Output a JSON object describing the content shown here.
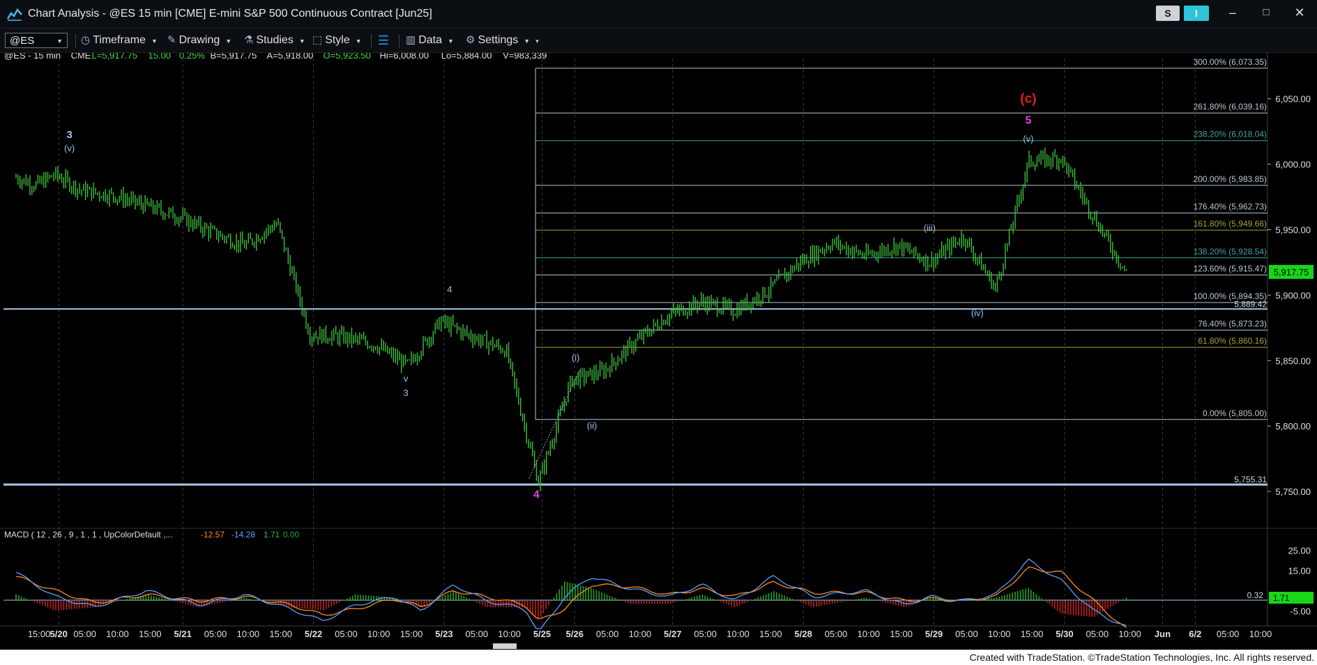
{
  "window": {
    "title": "Chart Analysis - @ES 15 min [CME] E-mini S&P 500 Continuous Contract [Jun25]",
    "s_button": "S",
    "i_button": "I",
    "minimize": "–",
    "maximize": "□",
    "close": "✕"
  },
  "toolbar": {
    "symbol": "@ES",
    "items": [
      "Timeframe",
      "Drawing",
      "Studies",
      "Style",
      "Data",
      "Settings"
    ]
  },
  "colors": {
    "background": "#000000",
    "price_bars": "#3fbf3f",
    "fib_line": "#b9c8d6",
    "fib_teal": "#3aa7a0",
    "fib_olive": "#a8a23a",
    "support_line": "#a8c8e8",
    "wave_label": "#9cc4ee",
    "wave_red": "#e02020",
    "wave_magenta": "#e040e0",
    "macd_line": "#5aa0ff",
    "signal_line": "#ff8c1a",
    "hist_up": "#28a028",
    "hist_down": "#c02020",
    "last_price_badge": "#16d616"
  },
  "chart_data": [
    {
      "type": "line",
      "subtype": "ohlc-bars",
      "info_line": {
        "symbol": "@ES - 15 min",
        "exchange": "CME",
        "last": "L=5,917.75",
        "change": "15.00",
        "pct": "0.25%",
        "bid": "B=5,917.75",
        "ask": "A=5,918.00",
        "open": "O=5,923.50",
        "high": "Hi=6,008.00",
        "low": "Lo=5,884.00",
        "volume": "V=983,339"
      },
      "ylim": [
        5725,
        6085
      ],
      "y_ticks": [
        {
          "value": 6050,
          "label": "6,050.00"
        },
        {
          "value": 6000,
          "label": "6,000.00"
        },
        {
          "value": 5950,
          "label": "5,950.00"
        },
        {
          "value": 5900,
          "label": "5,900.00"
        },
        {
          "value": 5850,
          "label": "5,850.00"
        },
        {
          "value": 5800,
          "label": "5,800.00"
        },
        {
          "value": 5750,
          "label": "5,750.00"
        }
      ],
      "x_ticks": [
        {
          "label": "15:00",
          "bold": false,
          "t": 0.03
        },
        {
          "label": "5/20",
          "bold": true,
          "t": 0.06
        },
        {
          "label": "05:00",
          "bold": false,
          "t": 0.1
        },
        {
          "label": "10:00",
          "bold": false,
          "t": 0.15
        },
        {
          "label": "15:00",
          "bold": false,
          "t": 0.2
        },
        {
          "label": "5/21",
          "bold": true,
          "t": 0.25
        },
        {
          "label": "05:00",
          "bold": false,
          "t": 0.3
        },
        {
          "label": "10:00",
          "bold": false,
          "t": 0.35
        },
        {
          "label": "15:00",
          "bold": false,
          "t": 0.4
        },
        {
          "label": "5/22",
          "bold": true,
          "t": 0.45
        },
        {
          "label": "05:00",
          "bold": false,
          "t": 0.5
        },
        {
          "label": "10:00",
          "bold": false,
          "t": 0.55
        },
        {
          "label": "15:00",
          "bold": false,
          "t": 0.6
        },
        {
          "label": "5/23",
          "bold": true,
          "t": 0.65
        },
        {
          "label": "05:00",
          "bold": false,
          "t": 0.7
        },
        {
          "label": "10:00",
          "bold": false,
          "t": 0.75
        },
        {
          "label": "5/25",
          "bold": true,
          "t": 0.8
        },
        {
          "label": "5/26",
          "bold": true,
          "t": 0.85
        },
        {
          "label": "05:00",
          "bold": false,
          "t": 0.9
        },
        {
          "label": "10:00",
          "bold": false,
          "t": 0.95
        },
        {
          "label": "5/27",
          "bold": true,
          "t": 1.0
        },
        {
          "label": "05:00",
          "bold": false,
          "t": 1.05
        },
        {
          "label": "10:00",
          "bold": false,
          "t": 1.1
        },
        {
          "label": "15:00",
          "bold": false,
          "t": 1.15
        },
        {
          "label": "5/28",
          "bold": true,
          "t": 1.2
        },
        {
          "label": "05:00",
          "bold": false,
          "t": 1.25
        },
        {
          "label": "10:00",
          "bold": false,
          "t": 1.3
        },
        {
          "label": "15:00",
          "bold": false,
          "t": 1.35
        },
        {
          "label": "5/29",
          "bold": true,
          "t": 1.4
        },
        {
          "label": "05:00",
          "bold": false,
          "t": 1.45
        },
        {
          "label": "10:00",
          "bold": false,
          "t": 1.5
        },
        {
          "label": "15:00",
          "bold": false,
          "t": 1.55
        },
        {
          "label": "5/30",
          "bold": true,
          "t": 1.6
        },
        {
          "label": "05:00",
          "bold": false,
          "t": 1.65
        },
        {
          "label": "10:00",
          "bold": false,
          "t": 1.7
        },
        {
          "label": "Jun",
          "bold": true,
          "t": 1.75
        },
        {
          "label": "6/2",
          "bold": true,
          "t": 1.8
        },
        {
          "label": "05:00",
          "bold": false,
          "t": 1.85
        },
        {
          "label": "10:00",
          "bold": false,
          "t": 1.9
        }
      ],
      "price_path": [
        [
          0.0,
          5990
        ],
        [
          0.03,
          5984
        ],
        [
          0.06,
          5992
        ],
        [
          0.1,
          5980
        ],
        [
          0.15,
          5976
        ],
        [
          0.2,
          5968
        ],
        [
          0.25,
          5960
        ],
        [
          0.3,
          5948
        ],
        [
          0.35,
          5938
        ],
        [
          0.4,
          5955
        ],
        [
          0.45,
          5870
        ],
        [
          0.5,
          5868
        ],
        [
          0.55,
          5862
        ],
        [
          0.6,
          5846
        ],
        [
          0.65,
          5880
        ],
        [
          0.7,
          5868
        ],
        [
          0.75,
          5858
        ],
        [
          0.8,
          5757
        ],
        [
          0.85,
          5835
        ],
        [
          0.9,
          5842
        ],
        [
          0.95,
          5865
        ],
        [
          1.0,
          5885
        ],
        [
          1.05,
          5895
        ],
        [
          1.1,
          5888
        ],
        [
          1.15,
          5903
        ],
        [
          1.2,
          5925
        ],
        [
          1.25,
          5940
        ],
        [
          1.3,
          5930
        ],
        [
          1.35,
          5938
        ],
        [
          1.4,
          5925
        ],
        [
          1.45,
          5945
        ],
        [
          1.5,
          5905
        ],
        [
          1.55,
          6002
        ],
        [
          1.6,
          6005
        ],
        [
          1.65,
          5960
        ],
        [
          1.7,
          5917
        ]
      ],
      "fib_levels": [
        {
          "label": "300.00% (6,073.35)",
          "value": 6073.35,
          "tone": "line"
        },
        {
          "label": "261.80% (6,039.16)",
          "value": 6039.16,
          "tone": "line"
        },
        {
          "label": "238.20% (6,018.04)",
          "value": 6018.04,
          "tone": "teal"
        },
        {
          "label": "200.00% (5,983.85)",
          "value": 5983.85,
          "tone": "line"
        },
        {
          "label": "176.40% (5,962.73)",
          "value": 5962.73,
          "tone": "line"
        },
        {
          "label": "161.80% (5,949.66)",
          "value": 5949.66,
          "tone": "olive"
        },
        {
          "label": "138.20% (5,928.54)",
          "value": 5928.54,
          "tone": "teal"
        },
        {
          "label": "123.60% (5,915.47)",
          "value": 5915.47,
          "tone": "line"
        },
        {
          "label": "100.00% (5,894.35)",
          "value": 5894.35,
          "tone": "line"
        },
        {
          "label": "76.40% (5,873.23)",
          "value": 5873.23,
          "tone": "line"
        },
        {
          "label": "61.80% (5,860.16)",
          "value": 5860.16,
          "tone": "olive"
        },
        {
          "label": "0.00% (5,805.00)",
          "value": 5805.0,
          "tone": "line"
        }
      ],
      "fib_start_t": 0.79,
      "horizontal_lines": [
        {
          "value": 5889.42,
          "label": "5,889.42"
        },
        {
          "value": 5755.31,
          "label": "5,755.31"
        }
      ],
      "last_price": {
        "value": 5917.75,
        "label": "5,917.75"
      },
      "wave_labels": [
        {
          "text": "3",
          "t": 0.085,
          "value": 6020,
          "color": "wave_label",
          "bold": true,
          "size": 15
        },
        {
          "text": "(v)",
          "t": 0.085,
          "value": 6010,
          "color": "wave_label",
          "bold": false,
          "size": 13
        },
        {
          "text": "4",
          "t": 0.667,
          "value": 5902,
          "color": "wave_label",
          "bold": false,
          "size": 13
        },
        {
          "text": "v",
          "t": 0.6,
          "value": 5834,
          "color": "wave_label",
          "bold": false,
          "size": 13
        },
        {
          "text": "3",
          "t": 0.6,
          "value": 5823,
          "color": "wave_label",
          "bold": false,
          "size": 13
        },
        {
          "text": "4",
          "t": 0.8,
          "value": 5745,
          "color": "wave_magenta",
          "bold": true,
          "size": 16
        },
        {
          "text": "(i)",
          "t": 0.86,
          "value": 5850,
          "color": "wave_label",
          "bold": false,
          "size": 13
        },
        {
          "text": "(ii)",
          "t": 0.885,
          "value": 5798,
          "color": "wave_label",
          "bold": false,
          "size": 13
        },
        {
          "text": "(iii)",
          "t": 1.402,
          "value": 5949,
          "color": "wave_label",
          "bold": false,
          "size": 13
        },
        {
          "text": "(iv)",
          "t": 1.475,
          "value": 5884,
          "color": "wave_label",
          "bold": false,
          "size": 13
        },
        {
          "text": "(c)",
          "t": 1.553,
          "value": 6047,
          "color": "wave_red",
          "bold": true,
          "size": 19
        },
        {
          "text": "5",
          "t": 1.553,
          "value": 6031,
          "color": "wave_magenta",
          "bold": true,
          "size": 16
        },
        {
          "text": "(v)",
          "t": 1.553,
          "value": 6017,
          "color": "wave_label",
          "bold": false,
          "size": 13
        }
      ]
    },
    {
      "type": "bar",
      "subtype": "macd",
      "header": {
        "name": "MACD ( 12 , 26 , 9 , 1 , 1 , UpColorDefault ,...",
        "macd": "-12.57",
        "signal": "-14.28",
        "hist": "1.71",
        "extra": "0.00"
      },
      "ylim": [
        -10,
        32
      ],
      "y_ticks": [
        {
          "value": 25,
          "label": "25.00"
        },
        {
          "value": 15,
          "label": "15.00"
        },
        {
          "value": -5,
          "label": "-5.00"
        }
      ],
      "ref_line": {
        "value": 0.32,
        "label": "0.32"
      },
      "last_badge": {
        "value": 1.71,
        "label": "1.71"
      },
      "macd_path": [
        [
          0.0,
          14
        ],
        [
          0.06,
          2
        ],
        [
          0.12,
          -3
        ],
        [
          0.2,
          5
        ],
        [
          0.28,
          -2
        ],
        [
          0.35,
          3
        ],
        [
          0.42,
          -4
        ],
        [
          0.47,
          -10
        ],
        [
          0.52,
          -2
        ],
        [
          0.58,
          2
        ],
        [
          0.62,
          -5
        ],
        [
          0.67,
          8
        ],
        [
          0.72,
          0
        ],
        [
          0.78,
          -4
        ],
        [
          0.8,
          -16
        ],
        [
          0.84,
          2
        ],
        [
          0.88,
          12
        ],
        [
          0.94,
          6
        ],
        [
          1.0,
          2
        ],
        [
          1.05,
          8
        ],
        [
          1.1,
          0
        ],
        [
          1.16,
          12
        ],
        [
          1.22,
          2
        ],
        [
          1.3,
          5
        ],
        [
          1.36,
          -2
        ],
        [
          1.4,
          2
        ],
        [
          1.45,
          0
        ],
        [
          1.5,
          3
        ],
        [
          1.55,
          20
        ],
        [
          1.6,
          10
        ],
        [
          1.65,
          -5
        ],
        [
          1.7,
          -13
        ]
      ],
      "signal_path": [
        [
          0.0,
          12
        ],
        [
          0.06,
          5
        ],
        [
          0.12,
          -1
        ],
        [
          0.2,
          3
        ],
        [
          0.28,
          0
        ],
        [
          0.35,
          2
        ],
        [
          0.42,
          -2
        ],
        [
          0.47,
          -7
        ],
        [
          0.52,
          -4
        ],
        [
          0.58,
          1
        ],
        [
          0.62,
          -3
        ],
        [
          0.67,
          5
        ],
        [
          0.72,
          2
        ],
        [
          0.78,
          -2
        ],
        [
          0.8,
          -10
        ],
        [
          0.84,
          -4
        ],
        [
          0.88,
          8
        ],
        [
          0.94,
          7
        ],
        [
          1.0,
          3
        ],
        [
          1.05,
          6
        ],
        [
          1.1,
          2
        ],
        [
          1.16,
          9
        ],
        [
          1.22,
          4
        ],
        [
          1.3,
          4
        ],
        [
          1.36,
          0
        ],
        [
          1.4,
          1
        ],
        [
          1.45,
          0
        ],
        [
          1.5,
          2
        ],
        [
          1.55,
          16
        ],
        [
          1.6,
          14
        ],
        [
          1.65,
          0
        ],
        [
          1.7,
          -14
        ]
      ]
    }
  ],
  "footer": "Created with TradeStation. ©TradeStation Technologies, Inc. All rights reserved."
}
